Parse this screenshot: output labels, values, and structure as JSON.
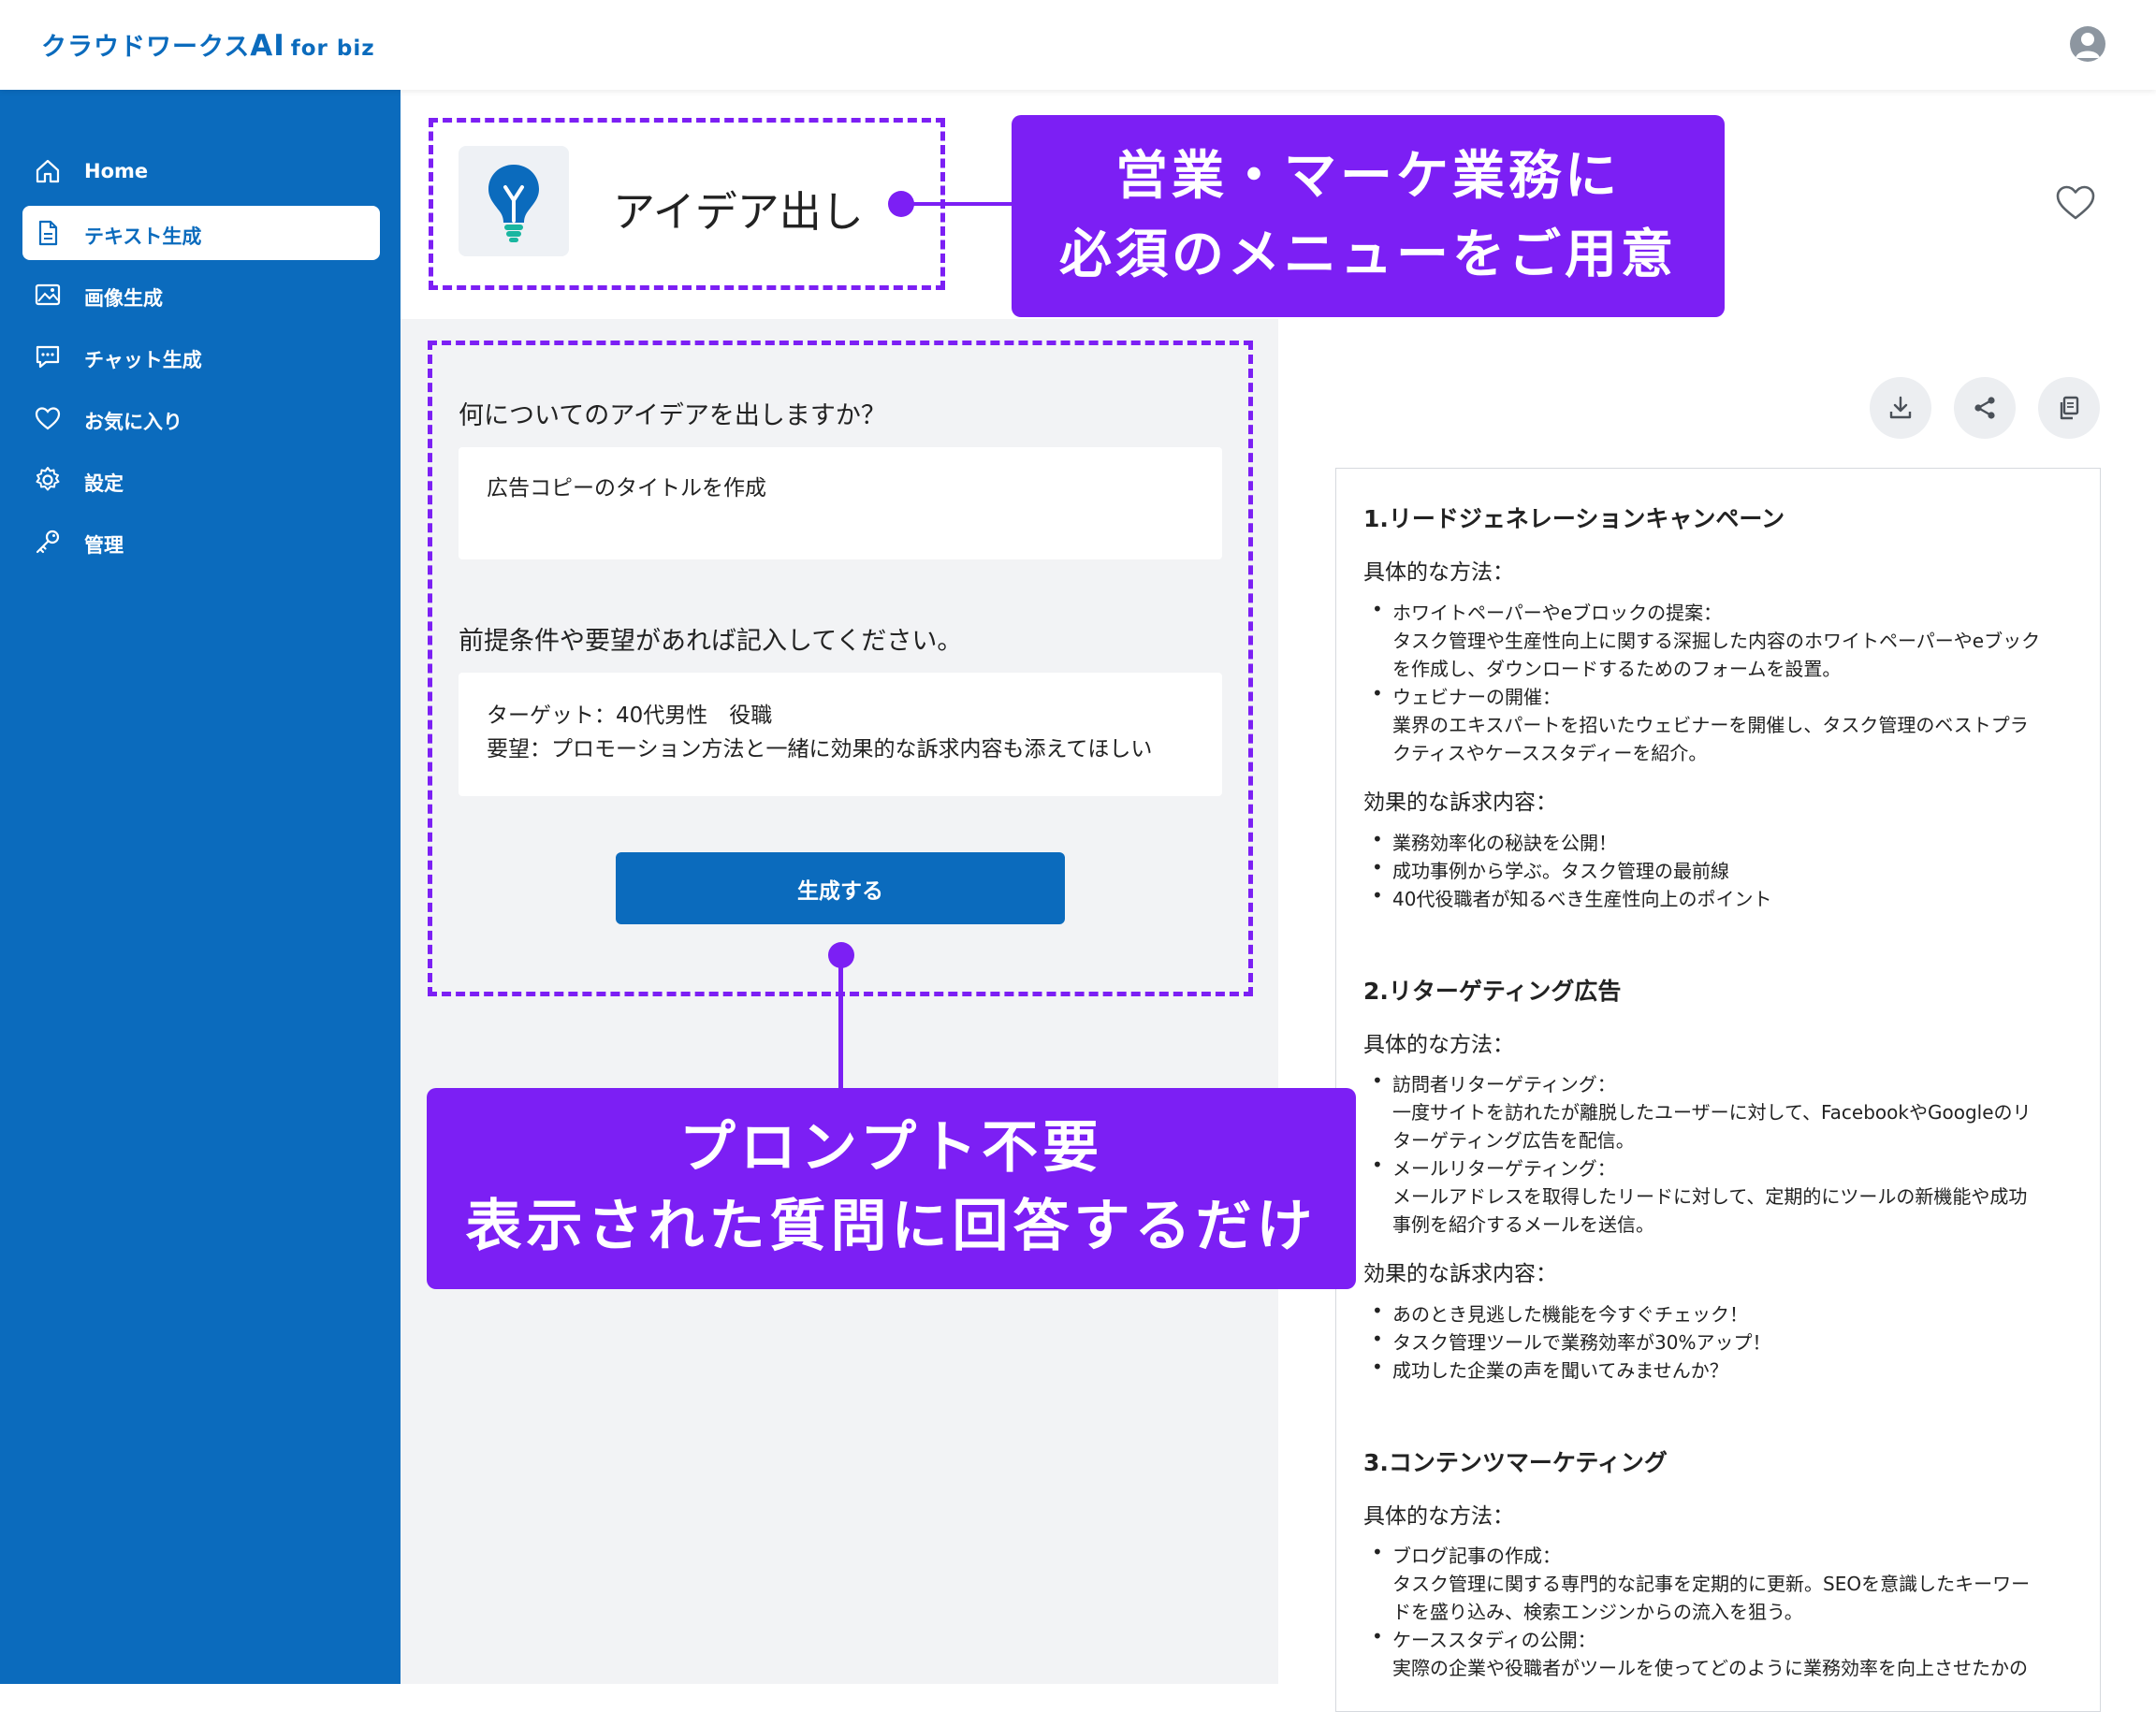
{
  "header": {
    "logo_main": "クラウドワークス",
    "logo_ai": "AI",
    "logo_biz": "for biz",
    "avatar_icon": "user-avatar-icon"
  },
  "sidebar": {
    "items": [
      {
        "label": "Home",
        "icon": "home-icon"
      },
      {
        "label": "テキスト生成",
        "icon": "document-icon"
      },
      {
        "label": "画像生成",
        "icon": "image-icon"
      },
      {
        "label": "チャット生成",
        "icon": "chat-icon"
      },
      {
        "label": "お気に入り",
        "icon": "heart-icon"
      },
      {
        "label": "設定",
        "icon": "gear-icon"
      },
      {
        "label": "管理",
        "icon": "key-icon"
      }
    ],
    "active_index": 1
  },
  "page": {
    "title": "アイデア出し",
    "title_icon": "lightbulb-icon",
    "favorite_icon": "heart-outline-icon"
  },
  "form": {
    "q1": {
      "label": "何についてのアイデアを出しますか？",
      "value": "広告コピーのタイトルを作成"
    },
    "q2": {
      "label": "前提条件や要望があれば記入してください。",
      "value_line1": "ターゲット：40代男性　役職",
      "value_line2": "要望：プロモーション方法と一緒に効果的な訴求内容も添えてほしい"
    },
    "generate_label": "生成する"
  },
  "result_actions": [
    {
      "icon": "download-icon"
    },
    {
      "icon": "share-icon"
    },
    {
      "icon": "copy-icon"
    }
  ],
  "result": {
    "s1": {
      "heading": "1.リードジェネレーションキャンペーン",
      "method_label": "具体的な方法：",
      "m1_title": "ホワイトペーパーやeブロックの提案：",
      "m1_l1": "タスク管理や生産性向上に関する深掘した内容のホワイトペーパーやeブック",
      "m1_l2": "を作成し、ダウンロードするためのフォームを設置。",
      "m2_title": "ウェビナーの開催：",
      "m2_l1": "業界のエキスパートを招いたウェビナーを開催し、タスク管理のベストプラ",
      "m2_l2": "クティスやケーススタディーを紹介。",
      "appeal_label": "効果的な訴求内容：",
      "a1": "業務効率化の秘訣を公開！",
      "a2": "成功事例から学ぶ。タスク管理の最前線",
      "a3": "40代役職者が知るべき生産性向上のポイント"
    },
    "s2": {
      "heading": "2.リターゲティング広告",
      "method_label": "具体的な方法：",
      "m1_title": "訪問者リターゲティング：",
      "m1_l1": "一度サイトを訪れたが離脱したユーザーに対して、FacebookやGoogleのリ",
      "m1_l2": "ターゲティング広告を配信。",
      "m2_title": "メールリターゲティング：",
      "m2_l1": "メールアドレスを取得したリードに対して、定期的にツールの新機能や成功",
      "m2_l2": "事例を紹介するメールを送信。",
      "appeal_label": "効果的な訴求内容：",
      "a1": "あのとき見逃した機能を今すぐチェック！",
      "a2": "タスク管理ツールで業務効率が30%アップ！",
      "a3": "成功した企業の声を聞いてみませんか？"
    },
    "s3": {
      "heading": "3.コンテンツマーケティング",
      "method_label": "具体的な方法：",
      "m1_title": "ブログ記事の作成：",
      "m1_l1": "タスク管理に関する専門的な記事を定期的に更新。SEOを意識したキーワー",
      "m1_l2": "ドを盛り込み、検索エンジンからの流入を狙う。",
      "m2_title": "ケーススタディの公開：",
      "m2_l1": "実際の企業や役職者がツールを使ってどのように業務効率を向上させたかの"
    }
  },
  "callouts": {
    "c1_line1": "営業・マーケ業務に",
    "c1_line2": "必須のメニューをご用意",
    "c2_line1": "プロンプト不要",
    "c2_line2": "表示された質問に回答するだけ"
  },
  "colors": {
    "brand": "#0b6bbd",
    "accent": "#7c1ff4",
    "panel": "#f2f3f5"
  }
}
